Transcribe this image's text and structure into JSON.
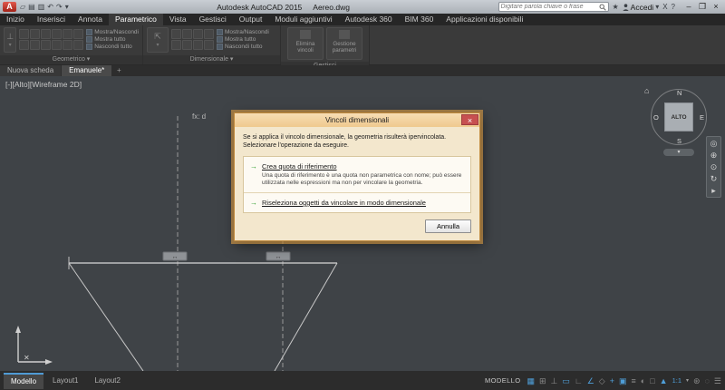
{
  "titlebar": {
    "logo": "A",
    "app_name": "Autodesk AutoCAD 2015",
    "doc_name": "Aereo.dwg",
    "qat": [
      {
        "name": "open-icon",
        "glyph": "▱"
      },
      {
        "name": "save-icon",
        "glyph": "▤"
      },
      {
        "name": "print-icon",
        "glyph": "▥"
      },
      {
        "name": "undo-icon",
        "glyph": "↶"
      },
      {
        "name": "redo-icon",
        "glyph": "↷"
      },
      {
        "name": "qat-dropdown-icon",
        "glyph": "▾"
      }
    ],
    "search_placeholder": "Digitare parola chiave o frase",
    "star": "★",
    "signin": "Accedi",
    "signin_caret": "▾",
    "exchange": "X",
    "help": "?",
    "window": {
      "minimize": "–",
      "restore": "❐",
      "close": "×"
    }
  },
  "ribbon": {
    "tabs": [
      "Inizio",
      "Inserisci",
      "Annota",
      "Parametrico",
      "Vista",
      "Gestisci",
      "Output",
      "Moduli aggiuntivi",
      "Autodesk 360",
      "BIM 360",
      "Applicazioni disponibili"
    ],
    "panels": {
      "geometrico": {
        "label": "Geometrico ▾",
        "show_hide": "Mostra/Nascondi",
        "show_all": "Mostra tutto",
        "hide_all": "Nascondi tutto"
      },
      "dimensionale": {
        "label": "Dimensionale ▾",
        "show_hide": "Mostra/Nascondi",
        "show_all": "Mostra tutto",
        "hide_all": "Nascondi tutto"
      },
      "gestisci": {
        "label": "Gestisci",
        "delete_constraints": "Elimina vincoli",
        "parameters_manager": "Gestione parametri"
      }
    }
  },
  "doc_tabs": {
    "new_tab": "Nuova scheda",
    "drawing_tab": "Emanuele*",
    "plus": "+"
  },
  "canvas": {
    "viewport_label": "[-][Alto][Wireframe 2D]",
    "fx_label": "fx: d",
    "viewcube": {
      "n": "N",
      "e": "E",
      "s": "S",
      "w": "O",
      "top": "ALTO",
      "home": "⌂",
      "menu_caret": "▾"
    },
    "navbar_icons": [
      {
        "name": "steering-wheel-icon",
        "glyph": "◎"
      },
      {
        "name": "pan-icon",
        "glyph": "⊕"
      },
      {
        "name": "zoom-icon",
        "glyph": "⊙"
      },
      {
        "name": "orbit-icon",
        "glyph": "↻"
      },
      {
        "name": "show-motion-icon",
        "glyph": "▸"
      }
    ]
  },
  "dialog": {
    "title": "Vincoli dimensionali",
    "close_glyph": "×",
    "arrow_glyph": "→",
    "message_line1": "Se si applica il vincolo dimensionale, la geometria risulterà ipervincolata.",
    "message_line2": "Selezionare l'operazione da eseguire.",
    "options": [
      {
        "title": "Crea quota di riferimento",
        "description": "Una quota di riferimento è una quota non parametrica con nome; può essere utilizzata nelle espressioni ma non per vincolare la geometria."
      },
      {
        "title": "Riseleziona oggetti da vincolare in modo dimensionale",
        "description": ""
      }
    ],
    "cancel": "Annulla"
  },
  "bottom": {
    "layout_tabs": [
      "Modello",
      "Layout1",
      "Layout2"
    ],
    "model_label": "MODELLO",
    "scale": "1:1",
    "scale_caret": "▾",
    "icons": [
      {
        "name": "grid-icon",
        "glyph": "▦"
      },
      {
        "name": "snap-mode-icon",
        "glyph": "⊞"
      },
      {
        "name": "infer-constraints-icon",
        "glyph": "⊥"
      },
      {
        "name": "dynamic-input-icon",
        "glyph": "▭"
      },
      {
        "name": "ortho-mode-icon",
        "glyph": "∟"
      },
      {
        "name": "polar-tracking-icon",
        "glyph": "∠"
      },
      {
        "name": "isometric-drafting-icon",
        "glyph": "◇"
      },
      {
        "name": "object-snap-tracking-icon",
        "glyph": "+"
      },
      {
        "name": "object-snap-icon",
        "glyph": "▣"
      },
      {
        "name": "lineweight-icon",
        "glyph": "≡"
      },
      {
        "name": "transparency-icon",
        "glyph": "◐"
      },
      {
        "name": "selection-cycling-icon",
        "glyph": "□"
      },
      {
        "name": "annotation-visibility-icon",
        "glyph": "▲"
      },
      {
        "name": "workspace-switching-icon",
        "glyph": "⊛"
      },
      {
        "name": "isolate-objects-icon",
        "glyph": "◌"
      },
      {
        "name": "customization-icon",
        "glyph": "☰"
      }
    ]
  }
}
